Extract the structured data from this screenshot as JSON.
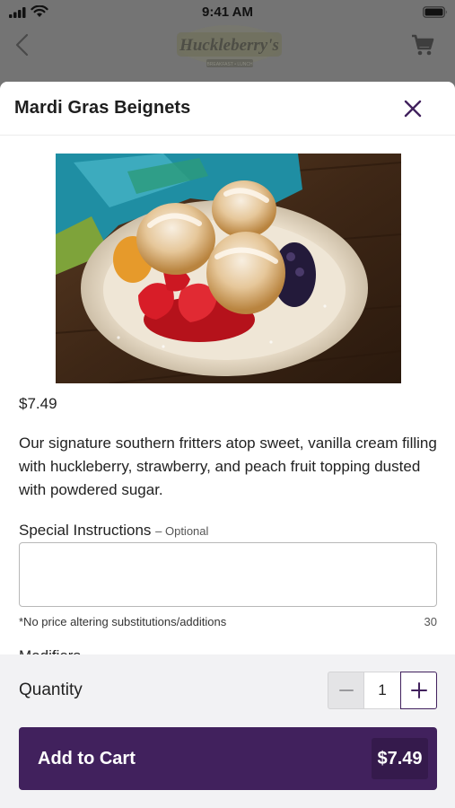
{
  "status_bar": {
    "time": "9:41 AM"
  },
  "header_bg": {
    "logo_text": "Huckleberry's",
    "logo_subtext": "BREAKFAST • LUNCH"
  },
  "item": {
    "title": "Mardi Gras Beignets",
    "price": "$7.49",
    "description": "Our signature southern fritters atop sweet, vanilla cream filling with huckleberry, strawberry, and peach fruit topping dusted with powdered sugar."
  },
  "instructions": {
    "label": "Special Instructions",
    "optional": "– Optional",
    "value": "",
    "placeholder": "",
    "note": "*No price altering substitutions/additions",
    "char_limit": "30"
  },
  "modifiers_peek": "Modifiers",
  "footer": {
    "quantity_label": "Quantity",
    "quantity_value": "1",
    "add_to_cart_label": "Add to Cart",
    "add_to_cart_price": "$7.49"
  },
  "colors": {
    "brand_purple": "#41215d",
    "brand_purple_dark": "#351a4c",
    "footer_bg": "#f2f2f4"
  }
}
